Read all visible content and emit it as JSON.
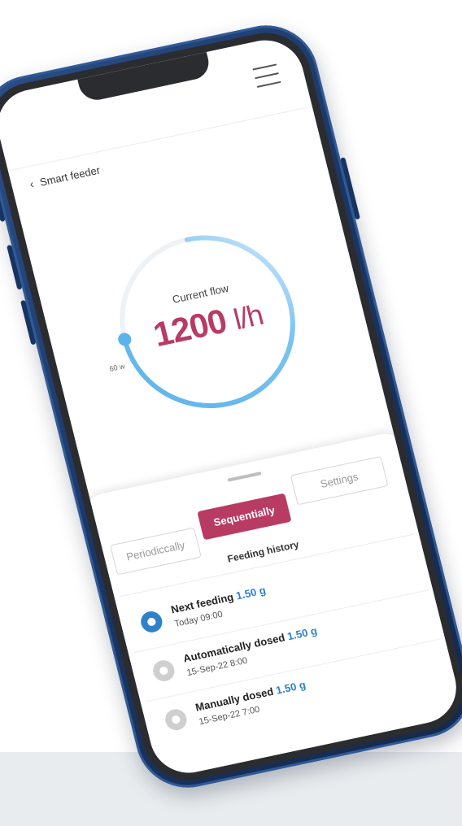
{
  "header": {
    "title": "Smart feeder",
    "back_icon": "chevron-left-icon",
    "menu_icon": "hamburger-menu-icon"
  },
  "flow": {
    "label": "Current flow",
    "value": "1200",
    "unit": "l/h",
    "min_label": "60 w",
    "ring_color": "#5bb3ea",
    "value_color": "#b83b63"
  },
  "tabs": [
    {
      "label": "Periodiccally",
      "active": false
    },
    {
      "label": "Sequentially",
      "active": true
    },
    {
      "label": "Settings",
      "active": false
    }
  ],
  "history": {
    "title": "Feeding history",
    "items": [
      {
        "label": "Next feeding",
        "amount": "1.50 g",
        "time": "Today 09:00",
        "state": "active"
      },
      {
        "label": "Automatically dosed",
        "amount": "1.50 g",
        "time": "15-Sep-22 8:00",
        "state": "inactive"
      },
      {
        "label": "Manually dosed",
        "amount": "1.50 g",
        "time": "15-Sep-22 7:00",
        "state": "inactive"
      }
    ]
  },
  "colors": {
    "accent": "#b83b63",
    "link_blue": "#2f82c8",
    "phone_frame": "#1b3766"
  }
}
